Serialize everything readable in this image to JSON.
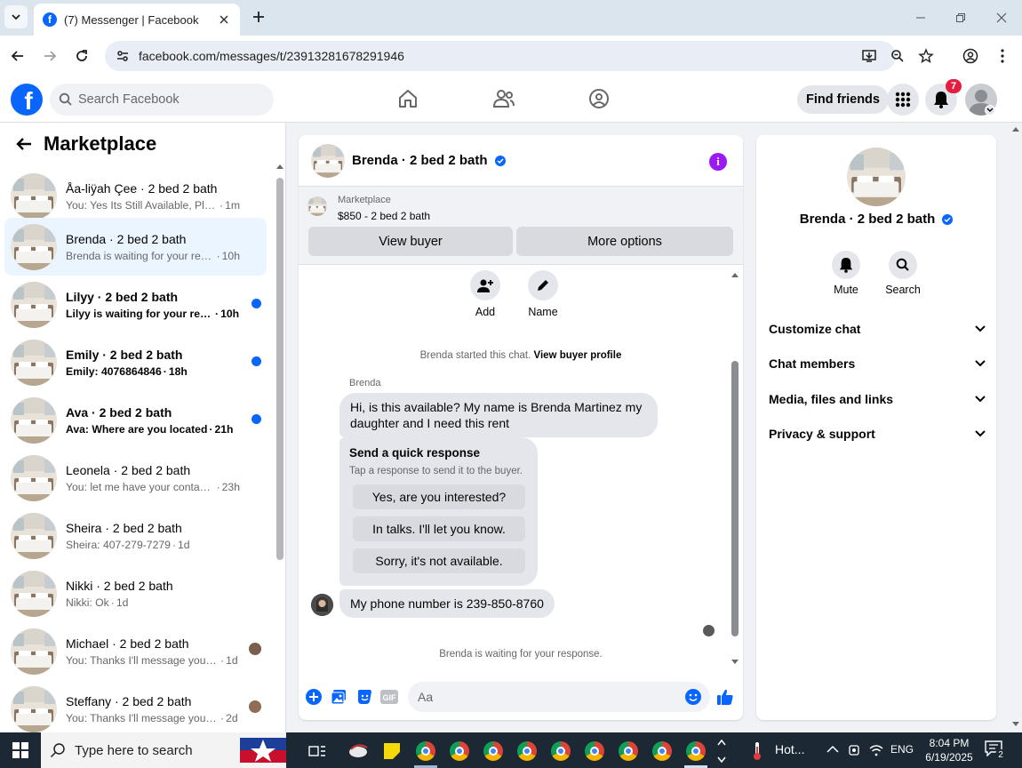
{
  "browser": {
    "tab_title": "(7) Messenger | Facebook",
    "url": "facebook.com/messages/t/23913281678291946"
  },
  "fb": {
    "search_placeholder": "Search Facebook",
    "find_friends": "Find friends",
    "notif_count": "7"
  },
  "marketplace": {
    "title": "Marketplace",
    "conversations": [
      {
        "name": "Åa-liÿah Çee · 2 bed 2 bath",
        "preview": "You: Yes Its Still Available, Please S...",
        "time": "1m",
        "unread": false
      },
      {
        "name": "Brenda · 2 bed 2 bath",
        "preview": "Brenda is waiting for your respon...",
        "time": "10h",
        "unread": false,
        "active": true
      },
      {
        "name": "Lilyy · 2 bed 2 bath",
        "preview": "Lilyy is waiting for your respo...",
        "time": "10h",
        "unread": true
      },
      {
        "name": "Emily · 2 bed 2 bath",
        "preview": "Emily: 4076864846",
        "time": "18h",
        "unread": true
      },
      {
        "name": "Ava · 2 bed 2 bath",
        "preview": "Ava: Where are you located",
        "time": "21h",
        "unread": true
      },
      {
        "name": "Leonela · 2 bed 2 bath",
        "preview": "You: let me have your contact nu...",
        "time": "23h",
        "unread": false
      },
      {
        "name": "Sheira · 2 bed 2 bath",
        "preview": "Sheira: 407-279-7279",
        "time": "1d",
        "unread": false
      },
      {
        "name": "Nikki · 2 bed 2 bath",
        "preview": "Nikki: Ok",
        "time": "1d",
        "unread": false
      },
      {
        "name": "Michael · 2 bed 2 bath",
        "preview": "You: Thanks I'll message you in ...",
        "time": "1d",
        "unread": false
      },
      {
        "name": "Steffany · 2 bed 2 bath",
        "preview": "You: Thanks I'll message you in ...",
        "time": "2d",
        "unread": false
      }
    ]
  },
  "chat": {
    "title": "Brenda · 2 bed 2 bath",
    "listing_label": "Marketplace",
    "listing_price": "$850 - 2 bed 2 bath",
    "view_buyer": "View buyer",
    "more_options": "More options",
    "add_label": "Add",
    "name_label": "Name",
    "started_text": "Brenda started this chat.",
    "started_link": "View buyer profile",
    "sender": "Brenda",
    "message1": "Hi, is this available? My name is Brenda Martinez my daughter and I need this rent",
    "quick_title": "Send a quick response",
    "quick_sub": "Tap a response to send it to the buyer.",
    "quick_responses": [
      "Yes, are you interested?",
      "In talks. I'll let you know.",
      "Sorry, it's not available."
    ],
    "message2": "My phone number is 239-850-8760",
    "waiting": "Brenda is waiting for your response.",
    "composer_placeholder": "Aa"
  },
  "info": {
    "name": "Brenda · 2 bed 2 bath",
    "mute": "Mute",
    "search": "Search",
    "sections": [
      "Customize chat",
      "Chat members",
      "Media, files and links",
      "Privacy & support"
    ]
  },
  "taskbar": {
    "search_placeholder": "Type here to search",
    "weather": "Hot...",
    "lang": "ENG",
    "time": "8:04 PM",
    "date": "6/19/2025",
    "notif_count": "2"
  }
}
